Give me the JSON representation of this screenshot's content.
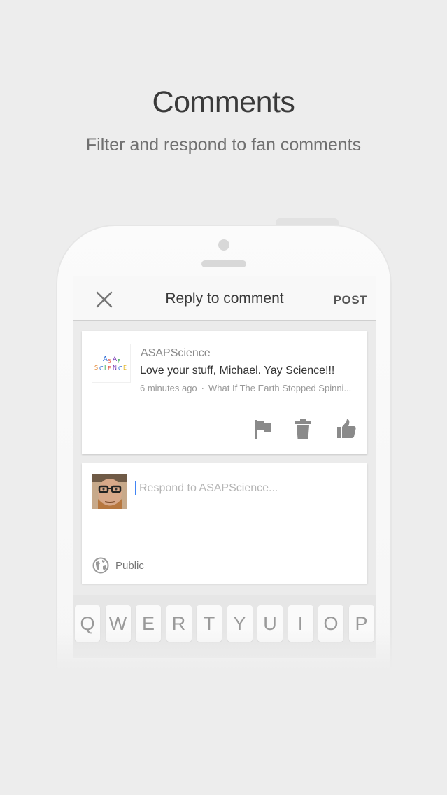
{
  "promo": {
    "title": "Comments",
    "subtitle": "Filter and respond to fan comments"
  },
  "screen": {
    "topbar": {
      "title": "Reply to comment",
      "post_label": "POST",
      "close_icon": "close-icon"
    },
    "comment": {
      "author": "ASAPScience",
      "text": "Love your stuff, Michael. Yay Science!!!",
      "time": "6 minutes ago",
      "separator": "·",
      "video": "What If The Earth Stopped Spinni...",
      "logo_text": "ASAP SCIENCE",
      "actions": [
        "flag-icon",
        "trash-icon",
        "thumbs-up-icon"
      ]
    },
    "reply": {
      "placeholder": "Respond to ASAPScience...",
      "value": "",
      "visibility": "Public",
      "visibility_icon": "globe-icon"
    },
    "keyboard": {
      "keys": [
        "Q",
        "W",
        "E",
        "R",
        "T",
        "Y",
        "U",
        "I",
        "O",
        "P"
      ]
    }
  },
  "colors": {
    "background": "#ededed",
    "cursor": "#4285f4",
    "icon": "#8a8a8a"
  }
}
